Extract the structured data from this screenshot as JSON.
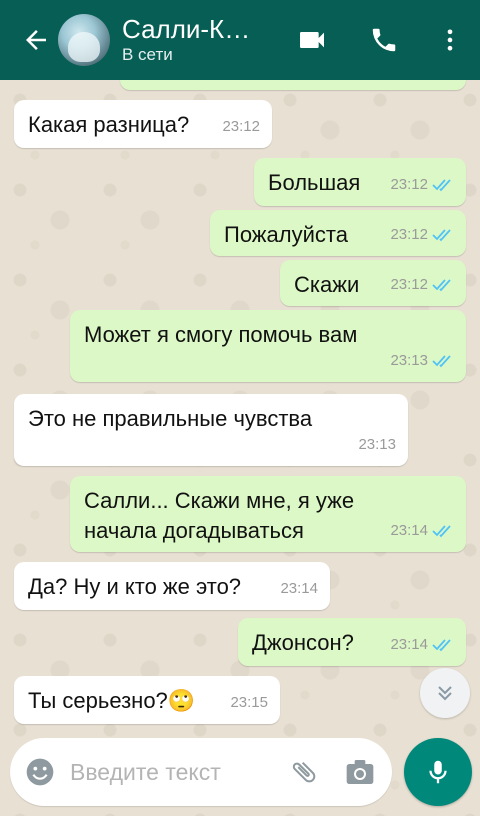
{
  "header": {
    "contact_name": "Салли-К…",
    "status": "В сети"
  },
  "messages": [
    {
      "direction": "in",
      "text": "Какая разница?",
      "time": "23:12"
    },
    {
      "direction": "out",
      "text": "Большая",
      "time": "23:12",
      "read": true
    },
    {
      "direction": "out",
      "text": "Пожалуйста",
      "time": "23:12",
      "read": true
    },
    {
      "direction": "out",
      "text": "Скажи",
      "time": "23:12",
      "read": true
    },
    {
      "direction": "out",
      "text": "Может я смогу помочь вам",
      "time": "23:13",
      "read": true
    },
    {
      "direction": "in",
      "text": "Это не правильные чувства",
      "time": "23:13"
    },
    {
      "direction": "out",
      "text": "Салли... Скажи мне, я уже начала догадываться",
      "time": "23:14",
      "read": true
    },
    {
      "direction": "in",
      "text": "Да? Ну и кто же это?",
      "time": "23:14"
    },
    {
      "direction": "out",
      "text": "Джонсон?",
      "time": "23:14",
      "read": true
    },
    {
      "direction": "in",
      "text": "Ты серьезно?🙄",
      "time": "23:15"
    }
  ],
  "composer": {
    "placeholder": "Введите текст"
  },
  "colors": {
    "header": "#075e54",
    "outgoing_bubble": "#dcf8c6",
    "incoming_bubble": "#ffffff",
    "read_ticks": "#4fc3f7",
    "mic_button": "#00897b"
  },
  "icons": {
    "back": "arrow-left-icon",
    "video": "video-camera-icon",
    "call": "phone-icon",
    "menu": "more-vert-icon",
    "emoji": "smiley-icon",
    "attach": "paperclip-icon",
    "camera": "camera-icon",
    "mic": "microphone-icon",
    "scroll": "double-chevron-down-icon"
  }
}
